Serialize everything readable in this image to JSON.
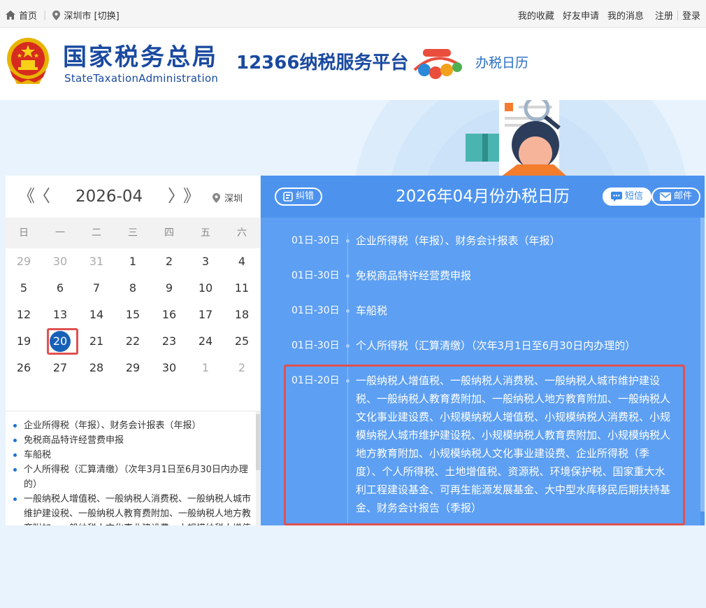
{
  "topbar": {
    "home_label": "首页",
    "city_label": "深圳市 [切换]",
    "links": [
      "我的收藏",
      "好友申请",
      "我的消息",
      "注册",
      "登录"
    ]
  },
  "header": {
    "brand_cn": "国家税务总局",
    "brand_en": "StateTaxationAdministration",
    "platform": "12366纳税服务平台",
    "page_name": "办税日历"
  },
  "calendar": {
    "prev_year": "《",
    "prev_month": "〈",
    "month_label": "2026-04",
    "next_month": "〉",
    "next_year": "》",
    "city": "深圳",
    "weekdays": [
      "日",
      "一",
      "二",
      "三",
      "四",
      "五",
      "六"
    ],
    "weeks": [
      [
        {
          "d": "29",
          "other": true
        },
        {
          "d": "30",
          "other": true
        },
        {
          "d": "31",
          "other": true
        },
        {
          "d": "1"
        },
        {
          "d": "2"
        },
        {
          "d": "3"
        },
        {
          "d": "4"
        }
      ],
      [
        {
          "d": "5"
        },
        {
          "d": "6"
        },
        {
          "d": "7"
        },
        {
          "d": "8"
        },
        {
          "d": "9"
        },
        {
          "d": "10"
        },
        {
          "d": "11"
        }
      ],
      [
        {
          "d": "12"
        },
        {
          "d": "13"
        },
        {
          "d": "14"
        },
        {
          "d": "15"
        },
        {
          "d": "16"
        },
        {
          "d": "17"
        },
        {
          "d": "18"
        }
      ],
      [
        {
          "d": "19"
        },
        {
          "d": "20",
          "selected": true
        },
        {
          "d": "21"
        },
        {
          "d": "22"
        },
        {
          "d": "23"
        },
        {
          "d": "24"
        },
        {
          "d": "25"
        }
      ],
      [
        {
          "d": "26"
        },
        {
          "d": "27"
        },
        {
          "d": "28"
        },
        {
          "d": "29"
        },
        {
          "d": "30"
        },
        {
          "d": "1",
          "other": true
        },
        {
          "d": "2",
          "other": true
        }
      ]
    ],
    "list": [
      "企业所得税（年报）、财务会计报表（年报）",
      "免税商品特许经营费申报",
      "车船税",
      "个人所得税（汇算清缴）（次年3月1日至6月30日内办理的）",
      "一般纳税人增值税、一般纳税人消费税、一般纳税人城市维护建设税、一般纳税人教育费附加、一般纳税人地方教育附加、一般纳税人文化事业建设费、小规模纳税人增值税"
    ]
  },
  "detail": {
    "title": "2026年04月份办税日历",
    "correct_label": "纠错",
    "sms_label": "短信",
    "mail_label": "邮件",
    "entries": [
      {
        "range": "01日-30日",
        "text": "企业所得税（年报）、财务会计报表（年报）"
      },
      {
        "range": "01日-30日",
        "text": "免税商品特许经营费申报"
      },
      {
        "range": "01日-30日",
        "text": "车船税"
      },
      {
        "range": "01日-30日",
        "text": "个人所得税（汇算清缴）（次年3月1日至6月30日内办理的）"
      },
      {
        "range": "01日-20日",
        "text": "一般纳税人增值税、一般纳税人消费税、一般纳税人城市维护建设税、一般纳税人教育费附加、一般纳税人地方教育附加、一般纳税人文化事业建设费、小规模纳税人增值税、小规模纳税人消费税、小规模纳税人城市维护建设税、小规模纳税人教育费附加、小规模纳税人地方教育附加、小规模纳税人文化事业建设费、企业所得税（季度）、个人所得税、土地增值税、资源税、环境保护税、国家重大水利工程建设基金、可再生能源发展基金、大中型水库移民后期扶持基金、财务会计报告（季报）"
      }
    ]
  },
  "colors": {
    "brand_blue": "#1a4aa0",
    "panel_blue": "#5d9ff2",
    "selected_day": "#1760b8",
    "highlight_red": "#e05151"
  }
}
